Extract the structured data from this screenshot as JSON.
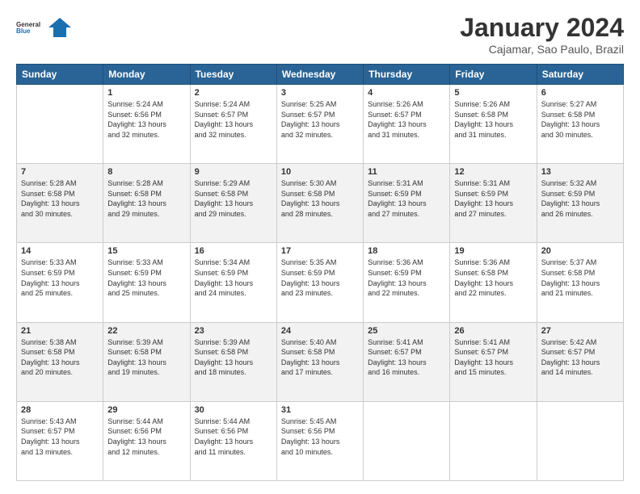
{
  "logo": {
    "line1": "General",
    "line2": "Blue"
  },
  "title": "January 2024",
  "subtitle": "Cajamar, Sao Paulo, Brazil",
  "days_of_week": [
    "Sunday",
    "Monday",
    "Tuesday",
    "Wednesday",
    "Thursday",
    "Friday",
    "Saturday"
  ],
  "weeks": [
    [
      {
        "day": "",
        "info": ""
      },
      {
        "day": "1",
        "info": "Sunrise: 5:24 AM\nSunset: 6:56 PM\nDaylight: 13 hours\nand 32 minutes."
      },
      {
        "day": "2",
        "info": "Sunrise: 5:24 AM\nSunset: 6:57 PM\nDaylight: 13 hours\nand 32 minutes."
      },
      {
        "day": "3",
        "info": "Sunrise: 5:25 AM\nSunset: 6:57 PM\nDaylight: 13 hours\nand 32 minutes."
      },
      {
        "day": "4",
        "info": "Sunrise: 5:26 AM\nSunset: 6:57 PM\nDaylight: 13 hours\nand 31 minutes."
      },
      {
        "day": "5",
        "info": "Sunrise: 5:26 AM\nSunset: 6:58 PM\nDaylight: 13 hours\nand 31 minutes."
      },
      {
        "day": "6",
        "info": "Sunrise: 5:27 AM\nSunset: 6:58 PM\nDaylight: 13 hours\nand 30 minutes."
      }
    ],
    [
      {
        "day": "7",
        "info": "Sunrise: 5:28 AM\nSunset: 6:58 PM\nDaylight: 13 hours\nand 30 minutes."
      },
      {
        "day": "8",
        "info": "Sunrise: 5:28 AM\nSunset: 6:58 PM\nDaylight: 13 hours\nand 29 minutes."
      },
      {
        "day": "9",
        "info": "Sunrise: 5:29 AM\nSunset: 6:58 PM\nDaylight: 13 hours\nand 29 minutes."
      },
      {
        "day": "10",
        "info": "Sunrise: 5:30 AM\nSunset: 6:58 PM\nDaylight: 13 hours\nand 28 minutes."
      },
      {
        "day": "11",
        "info": "Sunrise: 5:31 AM\nSunset: 6:59 PM\nDaylight: 13 hours\nand 27 minutes."
      },
      {
        "day": "12",
        "info": "Sunrise: 5:31 AM\nSunset: 6:59 PM\nDaylight: 13 hours\nand 27 minutes."
      },
      {
        "day": "13",
        "info": "Sunrise: 5:32 AM\nSunset: 6:59 PM\nDaylight: 13 hours\nand 26 minutes."
      }
    ],
    [
      {
        "day": "14",
        "info": "Sunrise: 5:33 AM\nSunset: 6:59 PM\nDaylight: 13 hours\nand 25 minutes."
      },
      {
        "day": "15",
        "info": "Sunrise: 5:33 AM\nSunset: 6:59 PM\nDaylight: 13 hours\nand 25 minutes."
      },
      {
        "day": "16",
        "info": "Sunrise: 5:34 AM\nSunset: 6:59 PM\nDaylight: 13 hours\nand 24 minutes."
      },
      {
        "day": "17",
        "info": "Sunrise: 5:35 AM\nSunset: 6:59 PM\nDaylight: 13 hours\nand 23 minutes."
      },
      {
        "day": "18",
        "info": "Sunrise: 5:36 AM\nSunset: 6:59 PM\nDaylight: 13 hours\nand 22 minutes."
      },
      {
        "day": "19",
        "info": "Sunrise: 5:36 AM\nSunset: 6:58 PM\nDaylight: 13 hours\nand 22 minutes."
      },
      {
        "day": "20",
        "info": "Sunrise: 5:37 AM\nSunset: 6:58 PM\nDaylight: 13 hours\nand 21 minutes."
      }
    ],
    [
      {
        "day": "21",
        "info": "Sunrise: 5:38 AM\nSunset: 6:58 PM\nDaylight: 13 hours\nand 20 minutes."
      },
      {
        "day": "22",
        "info": "Sunrise: 5:39 AM\nSunset: 6:58 PM\nDaylight: 13 hours\nand 19 minutes."
      },
      {
        "day": "23",
        "info": "Sunrise: 5:39 AM\nSunset: 6:58 PM\nDaylight: 13 hours\nand 18 minutes."
      },
      {
        "day": "24",
        "info": "Sunrise: 5:40 AM\nSunset: 6:58 PM\nDaylight: 13 hours\nand 17 minutes."
      },
      {
        "day": "25",
        "info": "Sunrise: 5:41 AM\nSunset: 6:57 PM\nDaylight: 13 hours\nand 16 minutes."
      },
      {
        "day": "26",
        "info": "Sunrise: 5:41 AM\nSunset: 6:57 PM\nDaylight: 13 hours\nand 15 minutes."
      },
      {
        "day": "27",
        "info": "Sunrise: 5:42 AM\nSunset: 6:57 PM\nDaylight: 13 hours\nand 14 minutes."
      }
    ],
    [
      {
        "day": "28",
        "info": "Sunrise: 5:43 AM\nSunset: 6:57 PM\nDaylight: 13 hours\nand 13 minutes."
      },
      {
        "day": "29",
        "info": "Sunrise: 5:44 AM\nSunset: 6:56 PM\nDaylight: 13 hours\nand 12 minutes."
      },
      {
        "day": "30",
        "info": "Sunrise: 5:44 AM\nSunset: 6:56 PM\nDaylight: 13 hours\nand 11 minutes."
      },
      {
        "day": "31",
        "info": "Sunrise: 5:45 AM\nSunset: 6:56 PM\nDaylight: 13 hours\nand 10 minutes."
      },
      {
        "day": "",
        "info": ""
      },
      {
        "day": "",
        "info": ""
      },
      {
        "day": "",
        "info": ""
      }
    ]
  ]
}
